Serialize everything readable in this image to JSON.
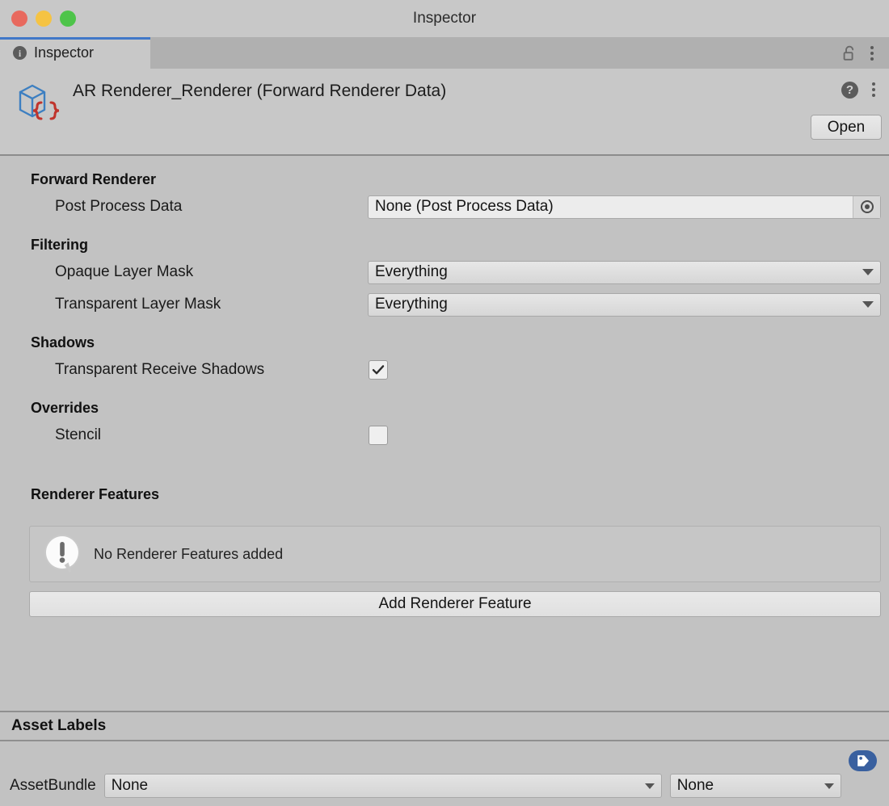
{
  "window": {
    "title": "Inspector",
    "traffic_lights": [
      {
        "name": "close",
        "color": "#e8695e"
      },
      {
        "name": "minimize",
        "color": "#f5c343"
      },
      {
        "name": "zoom",
        "color": "#4ec44a"
      }
    ]
  },
  "tabstrip": {
    "tab_label": "Inspector",
    "tab_icon": "info-icon",
    "lock_icon": "unlocked-padlock-icon",
    "menu_icon": "kebab-menu-icon",
    "accent_color": "#4178c8"
  },
  "asset_header": {
    "icon": "scriptable-object-icon",
    "title": "AR Renderer_Renderer (Forward Renderer Data)",
    "help_icon": "help-icon",
    "help_glyph": "?",
    "menu_icon": "kebab-menu-icon",
    "open_label": "Open"
  },
  "sections": {
    "forward_renderer": {
      "title": "Forward Renderer",
      "post_process_data": {
        "label": "Post Process Data",
        "value": "None (Post Process Data)",
        "picker_icon": "object-picker-icon"
      }
    },
    "filtering": {
      "title": "Filtering",
      "opaque_layer_mask": {
        "label": "Opaque Layer Mask",
        "value": "Everything"
      },
      "transparent_layer_mask": {
        "label": "Transparent Layer Mask",
        "value": "Everything"
      }
    },
    "shadows": {
      "title": "Shadows",
      "transparent_receive_shadows": {
        "label": "Transparent Receive Shadows",
        "checked": true
      }
    },
    "overrides": {
      "title": "Overrides",
      "stencil": {
        "label": "Stencil",
        "checked": false
      }
    },
    "renderer_features": {
      "title": "Renderer Features",
      "empty_message": "No Renderer Features added",
      "empty_icon": "info-bubble-icon",
      "add_button_label": "Add Renderer Feature"
    }
  },
  "asset_labels": {
    "title": "Asset Labels",
    "tag_button_icon": "tag-icon",
    "tag_button_color": "#39609f",
    "assetbundle_label": "AssetBundle",
    "assetbundle_value": "None",
    "assetbundle_variant_value": "None"
  }
}
